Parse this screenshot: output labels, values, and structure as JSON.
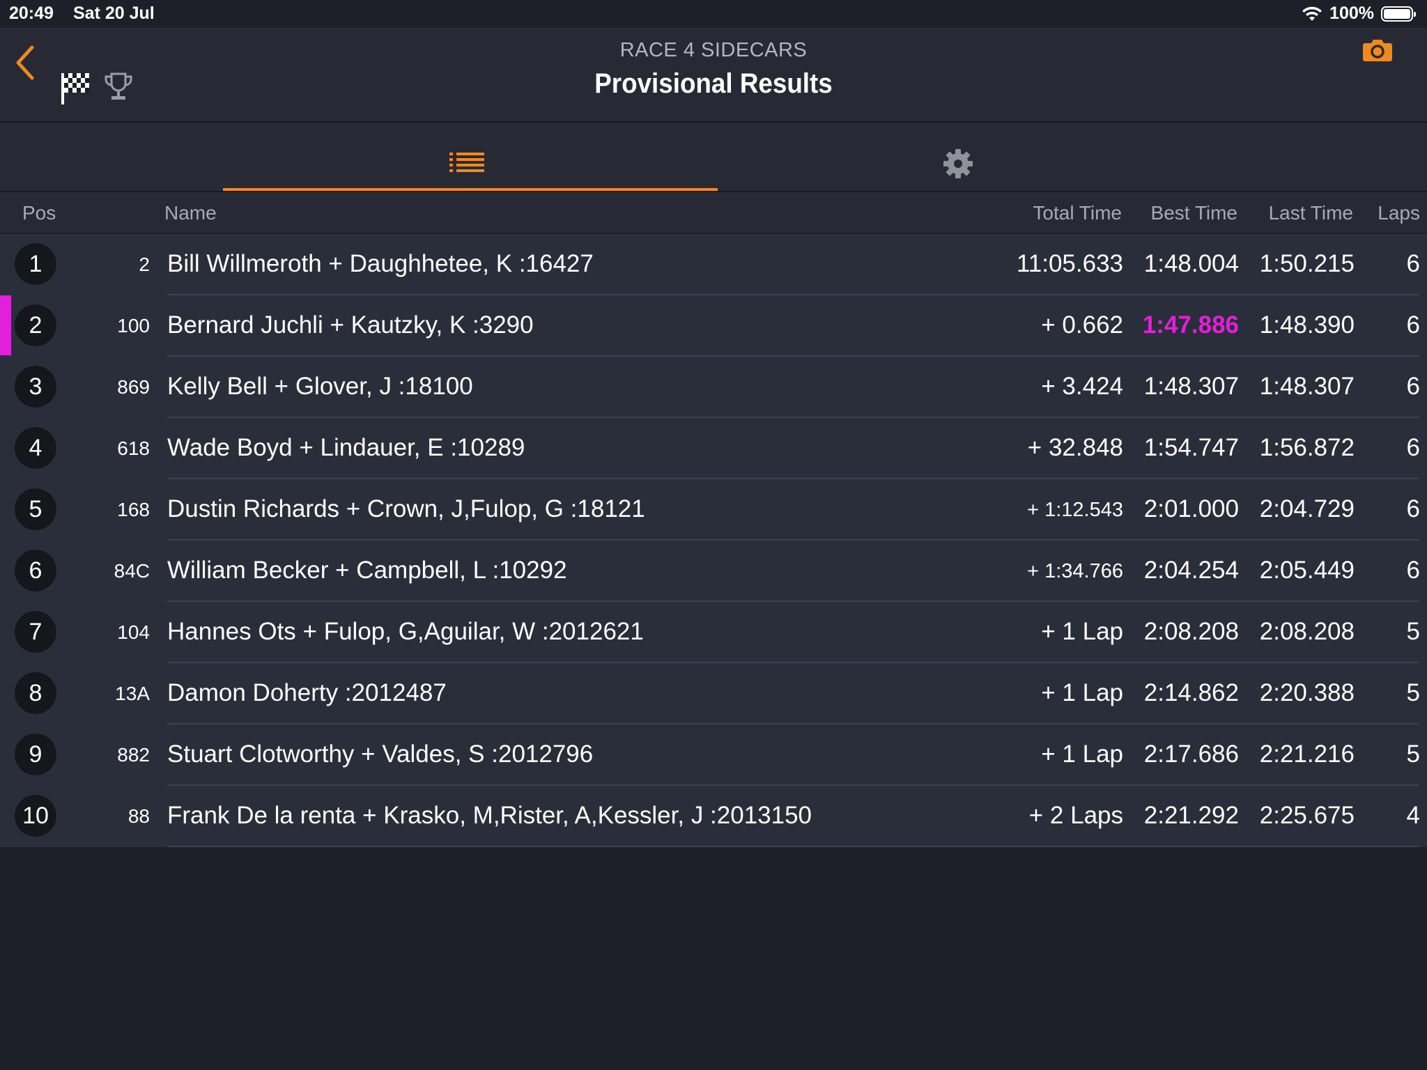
{
  "status": {
    "time": "20:49",
    "date": "Sat 20 Jul",
    "battery": "100%"
  },
  "header": {
    "subtitle": "RACE 4 SIDECARS",
    "title": "Provisional Results"
  },
  "colors": {
    "accent": "#f08a1c",
    "fastest": "#e21fd9",
    "background": "#1e2029",
    "row": "#2a2e3a"
  },
  "columns": {
    "pos": "Pos",
    "name": "Name",
    "total": "Total Time",
    "best": "Best Time",
    "last": "Last Time",
    "laps": "Laps"
  },
  "rows": [
    {
      "pos": "1",
      "num": "2",
      "name": "Bill Willmeroth + Daughhetee, K :16427",
      "total": "11:05.633",
      "best": "1:48.004",
      "last": "1:50.215",
      "laps": "6"
    },
    {
      "pos": "2",
      "num": "100",
      "name": "Bernard Juchli + Kautzky, K :3290",
      "total": "+ 0.662",
      "best": "1:47.886",
      "last": "1:48.390",
      "laps": "6"
    },
    {
      "pos": "3",
      "num": "869",
      "name": "Kelly Bell + Glover, J :18100",
      "total": "+ 3.424",
      "best": "1:48.307",
      "last": "1:48.307",
      "laps": "6"
    },
    {
      "pos": "4",
      "num": "618",
      "name": "Wade Boyd + Lindauer, E :10289",
      "total": "+ 32.848",
      "best": "1:54.747",
      "last": "1:56.872",
      "laps": "6"
    },
    {
      "pos": "5",
      "num": "168",
      "name": "Dustin Richards + Crown, J,Fulop, G :18121",
      "total": "+ 1:12.543",
      "best": "2:01.000",
      "last": "2:04.729",
      "laps": "6"
    },
    {
      "pos": "6",
      "num": "84C",
      "name": "William Becker + Campbell, L :10292",
      "total": "+ 1:34.766",
      "best": "2:04.254",
      "last": "2:05.449",
      "laps": "6"
    },
    {
      "pos": "7",
      "num": "104",
      "name": "Hannes Ots + Fulop, G,Aguilar, W :2012621",
      "total": "+ 1 Lap",
      "best": "2:08.208",
      "last": "2:08.208",
      "laps": "5"
    },
    {
      "pos": "8",
      "num": "13A",
      "name": "Damon Doherty :2012487",
      "total": "+ 1 Lap",
      "best": "2:14.862",
      "last": "2:20.388",
      "laps": "5"
    },
    {
      "pos": "9",
      "num": "882",
      "name": "Stuart Clotworthy + Valdes, S :2012796",
      "total": "+ 1 Lap",
      "best": "2:17.686",
      "last": "2:21.216",
      "laps": "5"
    },
    {
      "pos": "10",
      "num": "88",
      "name": "Frank De la renta + Krasko, M,Rister, A,Kessler, J :2013150",
      "total": "+ 2 Laps",
      "best": "2:21.292",
      "last": "2:25.675",
      "laps": "4"
    }
  ]
}
